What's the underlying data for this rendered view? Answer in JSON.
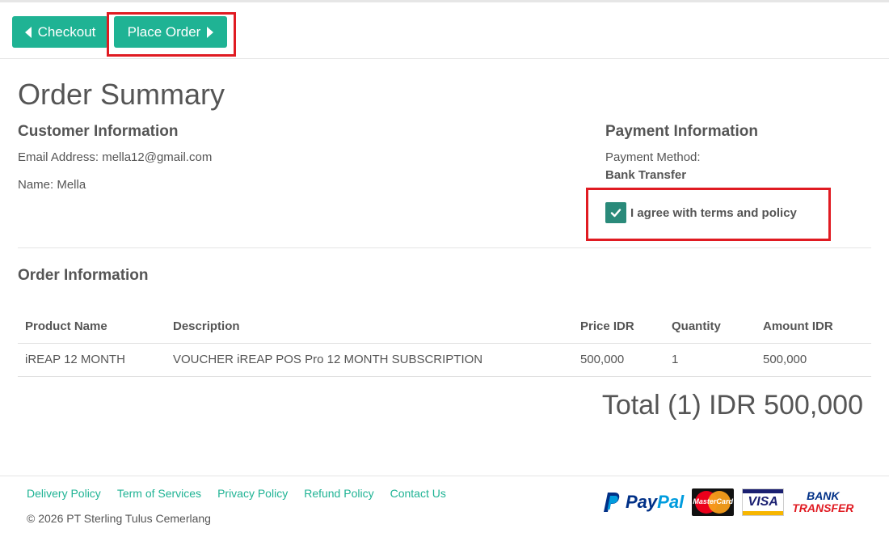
{
  "toolbar": {
    "checkout_label": "Checkout",
    "place_order_label": "Place Order"
  },
  "page_title": "Order Summary",
  "customer": {
    "heading": "Customer Information",
    "email_line": "Email Address: mella12@gmail.com",
    "name_line": "Name: Mella"
  },
  "payment": {
    "heading": "Payment Information",
    "method_label": "Payment Method:",
    "method_value": "Bank Transfer",
    "agree_label": "I agree with terms and policy",
    "agree_checked": true
  },
  "order": {
    "heading": "Order Information",
    "columns": [
      "Product Name",
      "Description",
      "Price IDR",
      "Quantity",
      "Amount IDR"
    ],
    "rows": [
      [
        "iREAP 12 MONTH",
        "VOUCHER iREAP POS Pro 12 MONTH SUBSCRIPTION",
        "500,000",
        "1",
        "500,000"
      ]
    ],
    "total": "Total (1) IDR 500,000"
  },
  "footer": {
    "links": [
      "Delivery Policy",
      "Term of Services",
      "Privacy Policy",
      "Refund Policy",
      "Contact Us"
    ],
    "copyright": "© 2026 PT Sterling Tulus Cemerlang",
    "payment_logos": {
      "paypal_a": "Pay",
      "paypal_b": "Pal",
      "mastercard": "MasterCard",
      "visa": "VISA",
      "bank_a": "BANK",
      "bank_b": "TRANSFER"
    }
  },
  "colors": {
    "accent": "#1fb394",
    "checkbox": "#2a8a7a",
    "highlight": "#e01b22",
    "text": "#555555"
  }
}
